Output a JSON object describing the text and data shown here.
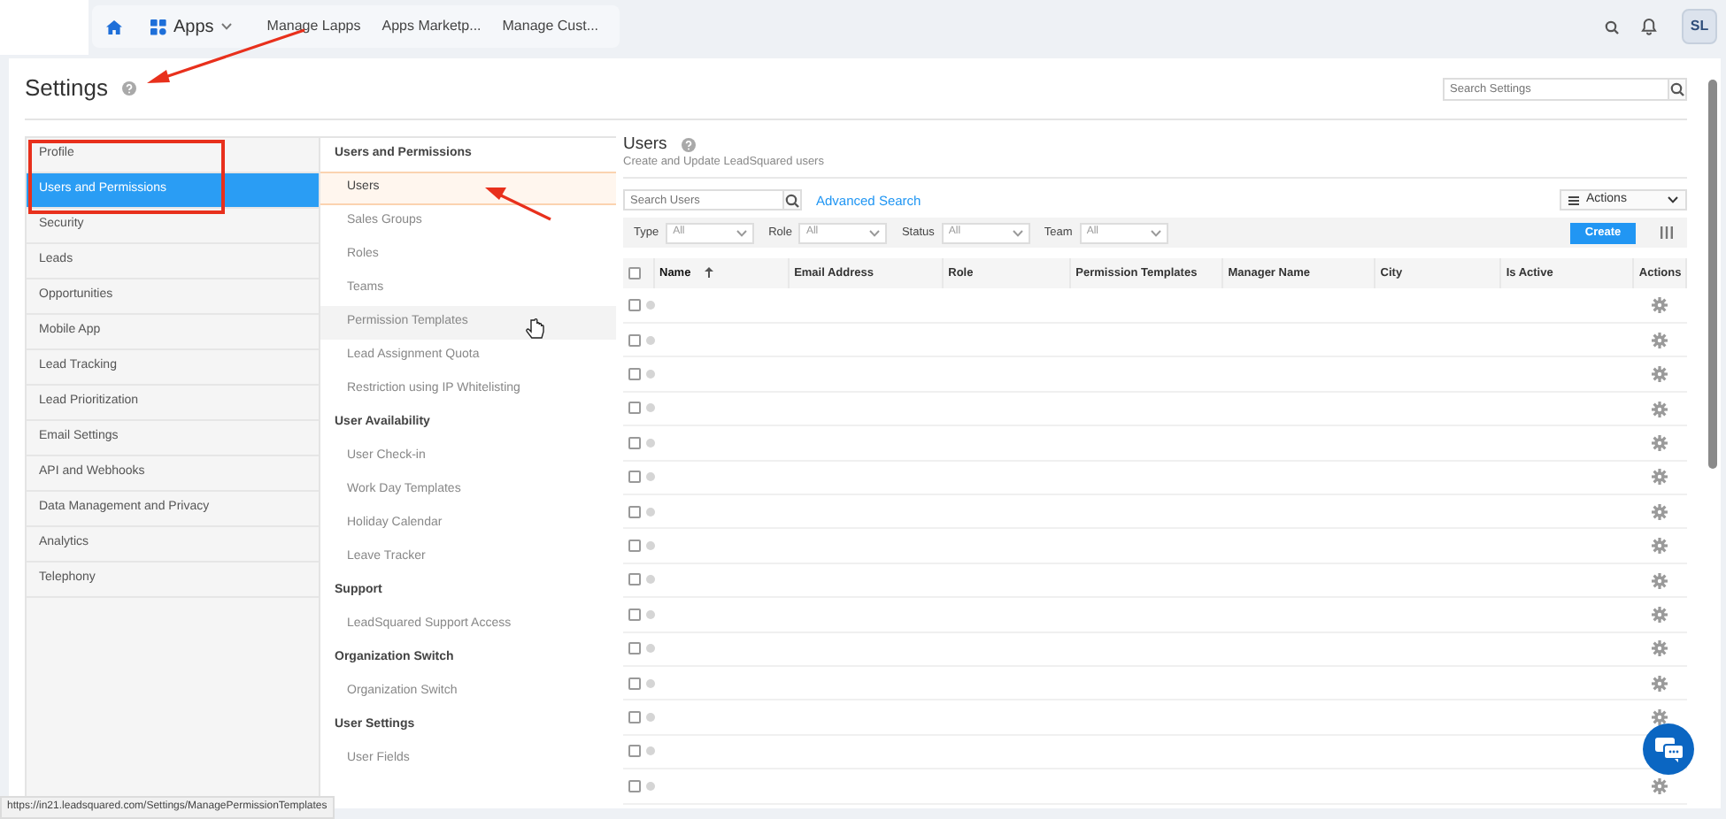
{
  "topbar": {
    "apps_menu": "Apps",
    "links": [
      "Manage Lapps",
      "Apps Marketp...",
      "Manage Cust..."
    ],
    "avatar": "SL"
  },
  "page": {
    "title": "Settings",
    "search_placeholder": "Search Settings"
  },
  "categories": [
    {
      "label": "Profile",
      "selected": false
    },
    {
      "label": "Users and Permissions",
      "selected": true
    },
    {
      "label": "Security",
      "selected": false
    },
    {
      "label": "Leads",
      "selected": false
    },
    {
      "label": "Opportunities",
      "selected": false
    },
    {
      "label": "Mobile App",
      "selected": false
    },
    {
      "label": "Lead Tracking",
      "selected": false
    },
    {
      "label": "Lead Prioritization",
      "selected": false
    },
    {
      "label": "Email Settings",
      "selected": false
    },
    {
      "label": "API and Webhooks",
      "selected": false
    },
    {
      "label": "Data Management and Privacy",
      "selected": false
    },
    {
      "label": "Analytics",
      "selected": false
    },
    {
      "label": "Telephony",
      "selected": false
    }
  ],
  "submenu": [
    {
      "heading": "Users and Permissions",
      "items": [
        {
          "label": "Users",
          "selected": true,
          "hovered": false
        },
        {
          "label": "Sales Groups",
          "selected": false,
          "hovered": false
        },
        {
          "label": "Roles",
          "selected": false,
          "hovered": false
        },
        {
          "label": "Teams",
          "selected": false,
          "hovered": false
        },
        {
          "label": "Permission Templates",
          "selected": false,
          "hovered": true
        },
        {
          "label": "Lead Assignment Quota",
          "selected": false,
          "hovered": false
        },
        {
          "label": "Restriction using IP Whitelisting",
          "selected": false,
          "hovered": false
        }
      ]
    },
    {
      "heading": "User Availability",
      "items": [
        {
          "label": "User Check-in",
          "selected": false,
          "hovered": false
        },
        {
          "label": "Work Day Templates",
          "selected": false,
          "hovered": false
        },
        {
          "label": "Holiday Calendar",
          "selected": false,
          "hovered": false
        },
        {
          "label": "Leave Tracker",
          "selected": false,
          "hovered": false
        }
      ]
    },
    {
      "heading": "Support",
      "items": [
        {
          "label": "LeadSquared Support Access",
          "selected": false,
          "hovered": false
        }
      ]
    },
    {
      "heading": "Organization Switch",
      "items": [
        {
          "label": "Organization Switch",
          "selected": false,
          "hovered": false
        }
      ]
    },
    {
      "heading": "User Settings",
      "items": [
        {
          "label": "User Fields",
          "selected": false,
          "hovered": false
        }
      ]
    }
  ],
  "users": {
    "title": "Users",
    "subtitle": "Create and Update LeadSquared users",
    "search_placeholder": "Search Users",
    "advanced_search": "Advanced Search",
    "actions": "Actions",
    "filters": [
      {
        "label": "Type",
        "value": "All"
      },
      {
        "label": "Role",
        "value": "All"
      },
      {
        "label": "Status",
        "value": "All"
      },
      {
        "label": "Team",
        "value": "All"
      }
    ],
    "create": "Create",
    "columns": [
      {
        "label": "Name",
        "sorted": true
      },
      {
        "label": "Email Address",
        "sorted": false
      },
      {
        "label": "Role",
        "sorted": false
      },
      {
        "label": "Permission Templates",
        "sorted": false
      },
      {
        "label": "Manager Name",
        "sorted": false
      },
      {
        "label": "City",
        "sorted": false
      },
      {
        "label": "Is Active",
        "sorted": false
      },
      {
        "label": "Actions",
        "sorted": false
      }
    ],
    "select_all_checked": false,
    "rows": [
      {
        "checked": false
      },
      {
        "checked": false
      },
      {
        "checked": false
      },
      {
        "checked": false
      },
      {
        "checked": false
      },
      {
        "checked": false
      },
      {
        "checked": false
      },
      {
        "checked": false
      },
      {
        "checked": false
      },
      {
        "checked": false
      },
      {
        "checked": false
      },
      {
        "checked": false
      },
      {
        "checked": false
      },
      {
        "checked": false
      },
      {
        "checked": false
      }
    ]
  },
  "status_url": "https://in21.leadsquared.com/Settings/ManagePermissionTemplates"
}
